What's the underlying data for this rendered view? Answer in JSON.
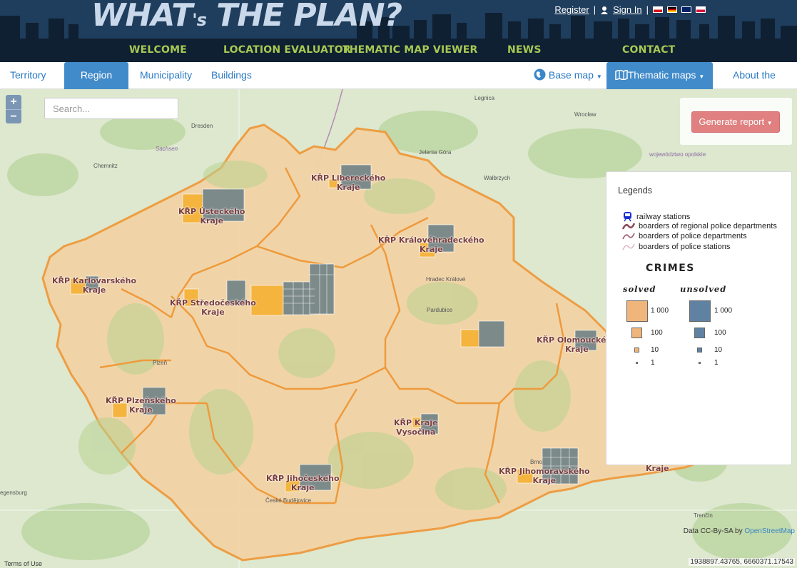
{
  "header": {
    "logo_main": "WHAT",
    "logo_apos": "'s",
    "logo_rest": " THE PLAN?",
    "register": "Register",
    "signin": "Sign In",
    "separator": "|",
    "nav": [
      "WELCOME",
      "LOCATION EVALUATOR",
      "THEMATIC MAP VIEWER",
      "NEWS",
      "CONTACT"
    ],
    "colors": {
      "bg": "#1f3d5c",
      "nav_bg": "#0f2033",
      "nav_text": "#a7c953"
    }
  },
  "tabs": {
    "territory": "Territory",
    "region": "Region",
    "municipality": "Municipality",
    "buildings": "Buildings",
    "base_map": "Base map",
    "thematic_maps": "Thematic maps",
    "about": "About the app"
  },
  "map": {
    "zoom_in": "+",
    "zoom_out": "−",
    "search_placeholder": "Search...",
    "generate_report": "Generate report",
    "attribution_prefix": "Data CC-By-SA by ",
    "attribution_link": "OpenStreetMap",
    "terms": "Terms of Use",
    "coordinates": "1938897.43765, 6660371.17543",
    "place_labels": {
      "legnica": "Legnica",
      "wroclaw": "Wrocław",
      "dresden": "Dresden",
      "sachsen": "Sachsen",
      "chemnitz": "Chemnitz",
      "jelenia": "Jelenia Góra",
      "walbrzych": "Wałbrzych",
      "opolskie": "województwo opolskie",
      "hradec": "Hradec Králové",
      "pardubice": "Pardubice",
      "plzen": "Plzeň",
      "brno": "Brno",
      "budejovice": "České Budějovice",
      "regensburg": "egensburg",
      "trencin": "Trenčín"
    },
    "regions": [
      {
        "name": "KŘP Libereckého\nKraje"
      },
      {
        "name": "KŘP Ústeckého\nKraje"
      },
      {
        "name": "KŘP Královéhradeckého\nKraje"
      },
      {
        "name": "KŘP Karlovarského\nKraje"
      },
      {
        "name": "KŘP Středočeského\nKraje"
      },
      {
        "name": "KŘP Olomouckého\nKraje"
      },
      {
        "name": "KŘP Plzeňského\nKraje"
      },
      {
        "name": "KŘP Kraje\nVysočina"
      },
      {
        "name": "KŘP Jihočeského\nKraje"
      },
      {
        "name": "KŘP Jihomoravského\nKraje"
      },
      {
        "name": "Kraje"
      }
    ]
  },
  "legend": {
    "title": "Legends",
    "items": [
      "railway stations",
      "boarders of regional police departments",
      "boarders of police departments",
      "boarders of police stations"
    ],
    "crimes": "CRIMES",
    "solved": "solved",
    "unsolved": "unsolved",
    "scale": [
      "1 000",
      "100",
      "10",
      "1"
    ],
    "colors": {
      "solved": "#f0b57a",
      "unsolved": "#5f82a2"
    }
  }
}
